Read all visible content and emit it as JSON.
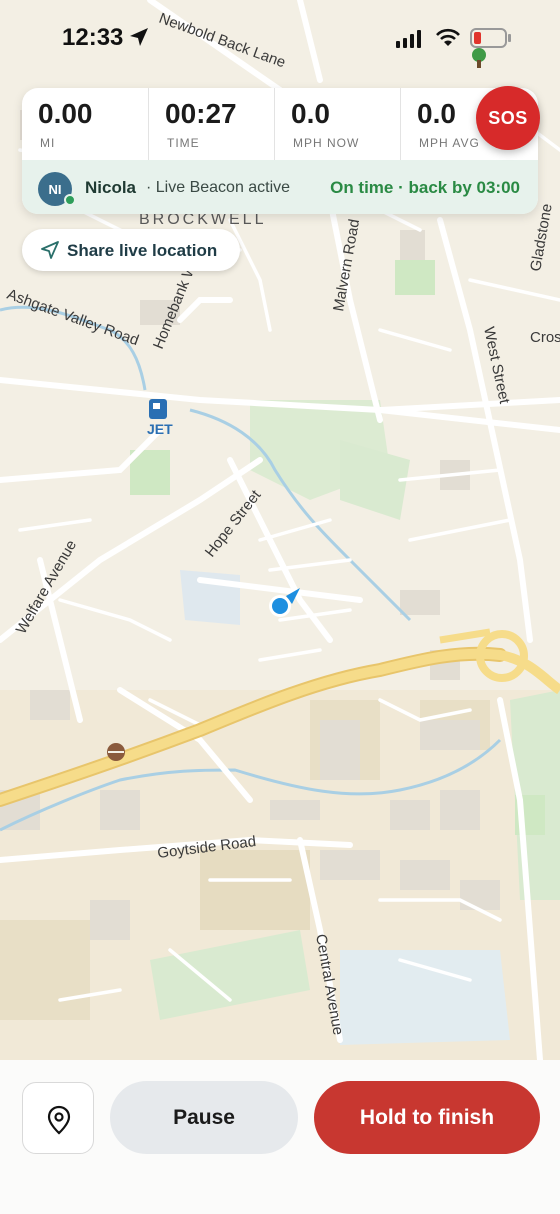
{
  "status_bar": {
    "time": "12:33",
    "location_icon": "navigation-arrow-icon",
    "signal_icon": "cellular-signal-icon",
    "wifi_icon": "wifi-icon",
    "battery_icon": "battery-low-icon",
    "battery_color": "#e0342c"
  },
  "stats": [
    {
      "value": "0.00",
      "label": "MI"
    },
    {
      "value": "00:27",
      "label": "TIME"
    },
    {
      "value": "0.0",
      "label": "MPH NOW"
    },
    {
      "value": "0.0",
      "label": "MPH AVG"
    }
  ],
  "sos": {
    "label": "SOS",
    "color": "#d72a2a"
  },
  "beacon": {
    "avatar_initials": "NI",
    "name": "Nicola",
    "status": "· Live Beacon active",
    "eta": "On time · back by 03:00",
    "eta_color": "#2a8a44"
  },
  "share": {
    "label": "Share live location",
    "icon": "navigation-outline-icon"
  },
  "map": {
    "labels": {
      "newbold": "Newbold Back Lane",
      "brockwell": "BROCKWELL",
      "gladstone": "Gladstone",
      "cross": "Cros",
      "ashgate": "Ashgate Valley Road",
      "homebank": "Homebank West",
      "malvern": "Malvern Road",
      "west_street": "West Street",
      "jet": "JET",
      "hope": "Hope Street",
      "welfare": "Welfare Avenue",
      "goytside": "Goytside Road",
      "central": "Central Avenue"
    },
    "icons": [
      "fuel-station-icon",
      "burger-icon",
      "tree-icon",
      "user-location-icon"
    ]
  },
  "controls": {
    "pin_icon": "map-pin-icon",
    "pause_label": "Pause",
    "finish_label": "Hold to finish",
    "finish_color": "#c83730"
  }
}
